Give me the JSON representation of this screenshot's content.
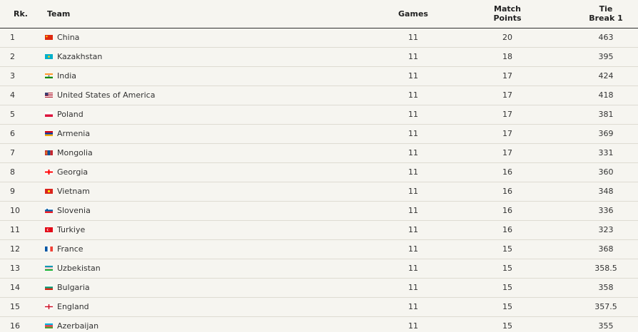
{
  "header": {
    "rank": "Rk.",
    "team": "Team",
    "games": "Games",
    "match_points_line1": "Match",
    "match_points_line2": "Points",
    "tiebreak_line1": "Tie",
    "tiebreak_line2": "Break 1"
  },
  "rows": [
    {
      "rank": "1",
      "team": "China",
      "flag": "china-flag-icon",
      "games": "11",
      "match_points": "20",
      "tiebreak": "463"
    },
    {
      "rank": "2",
      "team": "Kazakhstan",
      "flag": "kazakhstan-flag-icon",
      "games": "11",
      "match_points": "18",
      "tiebreak": "395"
    },
    {
      "rank": "3",
      "team": "India",
      "flag": "india-flag-icon",
      "games": "11",
      "match_points": "17",
      "tiebreak": "424"
    },
    {
      "rank": "4",
      "team": "United States of America",
      "flag": "usa-flag-icon",
      "games": "11",
      "match_points": "17",
      "tiebreak": "418"
    },
    {
      "rank": "5",
      "team": "Poland",
      "flag": "poland-flag-icon",
      "games": "11",
      "match_points": "17",
      "tiebreak": "381"
    },
    {
      "rank": "6",
      "team": "Armenia",
      "flag": "armenia-flag-icon",
      "games": "11",
      "match_points": "17",
      "tiebreak": "369"
    },
    {
      "rank": "7",
      "team": "Mongolia",
      "flag": "mongolia-flag-icon",
      "games": "11",
      "match_points": "17",
      "tiebreak": "331"
    },
    {
      "rank": "8",
      "team": "Georgia",
      "flag": "georgia-flag-icon",
      "games": "11",
      "match_points": "16",
      "tiebreak": "360"
    },
    {
      "rank": "9",
      "team": "Vietnam",
      "flag": "vietnam-flag-icon",
      "games": "11",
      "match_points": "16",
      "tiebreak": "348"
    },
    {
      "rank": "10",
      "team": "Slovenia",
      "flag": "slovenia-flag-icon",
      "games": "11",
      "match_points": "16",
      "tiebreak": "336"
    },
    {
      "rank": "11",
      "team": "Turkiye",
      "flag": "turkiye-flag-icon",
      "games": "11",
      "match_points": "16",
      "tiebreak": "323"
    },
    {
      "rank": "12",
      "team": "France",
      "flag": "france-flag-icon",
      "games": "11",
      "match_points": "15",
      "tiebreak": "368"
    },
    {
      "rank": "13",
      "team": "Uzbekistan",
      "flag": "uzbekistan-flag-icon",
      "games": "11",
      "match_points": "15",
      "tiebreak": "358.5"
    },
    {
      "rank": "14",
      "team": "Bulgaria",
      "flag": "bulgaria-flag-icon",
      "games": "11",
      "match_points": "15",
      "tiebreak": "358"
    },
    {
      "rank": "15",
      "team": "England",
      "flag": "england-flag-icon",
      "games": "11",
      "match_points": "15",
      "tiebreak": "357.5"
    },
    {
      "rank": "16",
      "team": "Azerbaijan",
      "flag": "azerbaijan-flag-icon",
      "games": "11",
      "match_points": "15",
      "tiebreak": "355"
    }
  ]
}
